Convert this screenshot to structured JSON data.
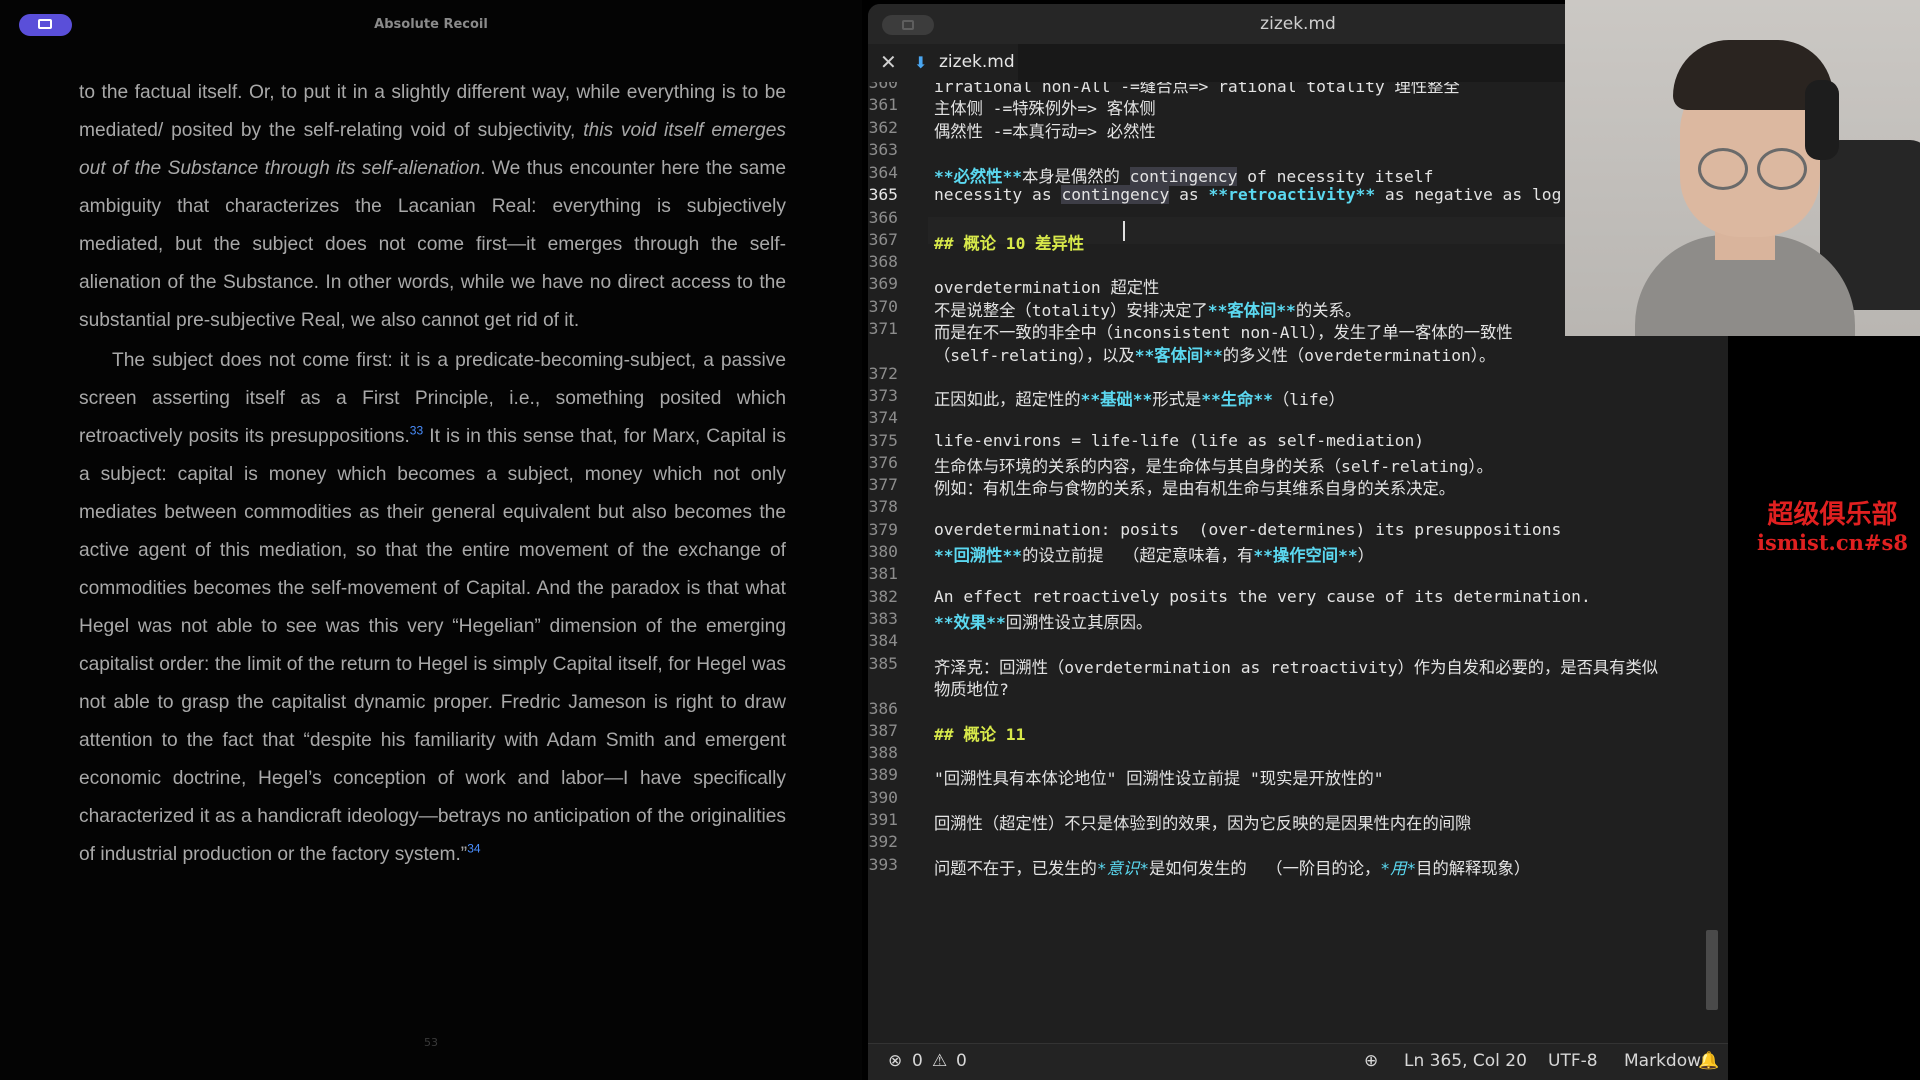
{
  "reader": {
    "title": "Absolute Recoil",
    "page_number": "53",
    "p1_a": "to the factual itself. Or, to put it in a slightly different way, while every­thing is to be mediated/ posited by the self-relating void of subjectivity, ",
    "p1_italic": "this void itself emerges out of the Substance through its self-alienation",
    "p1_b": ". We thus encounter here the same ambiguity that characterizes the Lacanian Real: everything is subjectively mediated, but the subject does not come first—it emerges through the self-alienation of the Substance. In other words, while we have no direct access to the substantial pre-subjective Real, we also cannot get rid of it.",
    "p2_a": "The subject does not come first: it is a predicate-becoming-subject, a passive screen asserting itself as a First Principle, i.e., something posited which retroactively posits its presuppositions.",
    "footnote_33": "33",
    "p2_b": " It is in this sense that, for Marx, Capital is a subject: capital is money which becomes a subject, money which not only mediates between commodities as their general equivalent but also becomes the active agent of this mediation, so that the entire movement of the exchange of commodities becomes the self-movement of Capital. And the paradox is that what Hegel was not able to see was this very “Hegelian” dimension of the emerging capitalist order: the limit of the return to Hegel is simply Capital itself, for Hegel was not able to grasp the capitalist dynamic proper. Fredric Jameson is right to draw attention to the fact that “despite his familiarity with Adam Smith and emergent economic doctrine, Hegel’s conception of work and labor—I have specifically characterized it as a handicraft ideology—betrays no anticipation of the originalities of industrial production or the factory sys­tem.”",
    "footnote_34": "34"
  },
  "editor": {
    "window_title": "zizek.md",
    "tab_label": "zizek.md",
    "line_numbers": [
      "360",
      "361",
      "362",
      "363",
      "364",
      "365",
      "366",
      "367",
      "368",
      "369",
      "370",
      "371",
      "372",
      "373",
      "374",
      "375",
      "376",
      "377",
      "378",
      "379",
      "380",
      "381",
      "382",
      "383",
      "384",
      "385",
      "386",
      "387",
      "388",
      "389",
      "390",
      "391",
      "392",
      "393"
    ],
    "lines": {
      "l360": "irrational non-All -=缝合点=> rational totality 理性整全",
      "l361": "主体侧 -=特殊例外=> 客体侧",
      "l362": "偶然性 -=本真行动=> 必然性",
      "l364_b": "**必然性**",
      "l364_c": "本身是偶然的 ",
      "l364_d": "contingency",
      "l364_e": " of necessity itself",
      "l365_a": "necessity as ",
      "l365_b": "contingency",
      "l365_c": " as ",
      "l365_d": "**retroactivity**",
      "l365_e": " as negative as log",
      "l367": "## 概论 10 差异性",
      "l369": "overdetermination 超定性",
      "l370_a": "不是说整全（totality）安排决定了",
      "l370_b": "**客体间**",
      "l370_c": "的关系。",
      "l371_a": "而是在不一致的非全中（inconsistent non-All），发生了单一客体的一致性",
      "l371_b": "（self-relating），以及",
      "l371_c": "**客体间**",
      "l371_d": "的多义性（overdetermination）。",
      "l373_a": "正因如此，超定性的",
      "l373_b": "**基础**",
      "l373_c": "形式是",
      "l373_d": "**生命**",
      "l373_e": "（life）",
      "l375": "life-environs = life-life (life as self-mediation)",
      "l376": "生命体与环境的关系的内容，是生命体与其自身的关系（self-relating）。",
      "l377": "例如：有机生命与食物的关系，是由有机生命与其维系自身的关系决定。",
      "l379": "overdetermination: posits  (over-determines) its presuppositions",
      "l380_a": "**回溯性**",
      "l380_b": "的设立前提  （超定意味着，有",
      "l380_c": "**操作空间**",
      "l380_d": "）",
      "l382": "An effect retroactively posits the very cause of its determination.",
      "l383_a": "**效果**",
      "l383_b": "回溯性设立其原因。",
      "l385_a": "齐泽克：回溯性（overdetermination as retroactivity）作为自发和必要的，是否具有类似",
      "l385_b": "物质地位?",
      "l387": "## 概论 11",
      "l389": "\"回溯性具有本体论地位\" 回溯性设立前提 \"现实是开放性的\"",
      "l391": "回溯性（超定性）不只是体验到的效果，因为它反映的是因果性内在的间隙",
      "l393_a": "问题不在于，已发生的",
      "l393_b": "*意识*",
      "l393_c": "是如何发生的  （一阶目的论，",
      "l393_d": "*用*",
      "l393_e": "目的解释现象）"
    },
    "status": {
      "errors": "0",
      "warnings": "0",
      "position": "Ln 365, Col 20",
      "encoding": "UTF-8",
      "language": "Markdown"
    }
  },
  "watermark": {
    "line1": "超级俱乐部",
    "line2": "ismist.cn#s8"
  },
  "colors": {
    "accent_pill": "#5a4fd9",
    "heading": "#d7e84a",
    "bold": "#5bd8f0",
    "watermark": "#e02020",
    "footnote": "#4a8fff"
  }
}
